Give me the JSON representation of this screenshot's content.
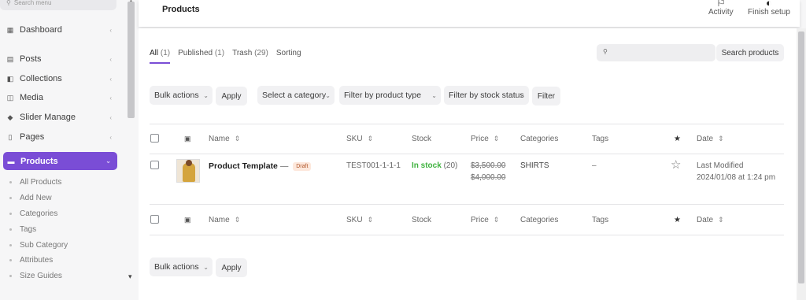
{
  "sidebar": {
    "search_placeholder": "Search menu",
    "items": [
      {
        "label": "Dashboard",
        "icon": "dashboard-icon"
      },
      {
        "label": "Posts",
        "icon": "posts-icon"
      },
      {
        "label": "Collections",
        "icon": "collections-icon"
      },
      {
        "label": "Media",
        "icon": "media-icon"
      },
      {
        "label": "Slider Manage",
        "icon": "slider-icon"
      },
      {
        "label": "Pages",
        "icon": "pages-icon"
      },
      {
        "label": "Products",
        "icon": "products-icon",
        "active": true
      }
    ],
    "submenu": [
      "All Products",
      "Add New",
      "Categories",
      "Tags",
      "Sub Category",
      "Attributes",
      "Size Guides"
    ]
  },
  "header": {
    "title": "Products",
    "activity_label": "Activity",
    "finish_setup_label": "Finish setup"
  },
  "views": {
    "all": {
      "label": "All",
      "count": "(1)"
    },
    "published": {
      "label": "Published",
      "count": "(1)"
    },
    "trash": {
      "label": "Trash",
      "count": "(29)"
    },
    "sorting": {
      "label": "Sorting"
    }
  },
  "search": {
    "placeholder": "",
    "button_label": "Search products"
  },
  "filters": {
    "bulk_actions": "Bulk actions",
    "apply": "Apply",
    "category": "Select a category",
    "product_type": "Filter by product type",
    "stock_status": "Filter by stock status",
    "filter_button": "Filter"
  },
  "table": {
    "columns": {
      "name": "Name",
      "sku": "SKU",
      "stock": "Stock",
      "price": "Price",
      "categories": "Categories",
      "tags": "Tags",
      "date": "Date"
    },
    "rows": [
      {
        "name": "Product Template",
        "dash": " — ",
        "status": "Draft",
        "sku": "TEST001-1-1-1",
        "stock_status": "In stock",
        "stock_count": "(20)",
        "price_regular": "$3,500.00",
        "price_sale": "$4,000.00",
        "categories": "SHIRTS",
        "tags": "–",
        "date_line1": "Last Modified",
        "date_line2": "2024/01/08 at 1:24 pm"
      }
    ]
  },
  "bottom": {
    "bulk_actions": "Bulk actions",
    "apply": "Apply"
  },
  "colors": {
    "accent": "#7a4dd6",
    "in_stock": "#3fb23f",
    "draft_bg": "#fde8dc"
  }
}
